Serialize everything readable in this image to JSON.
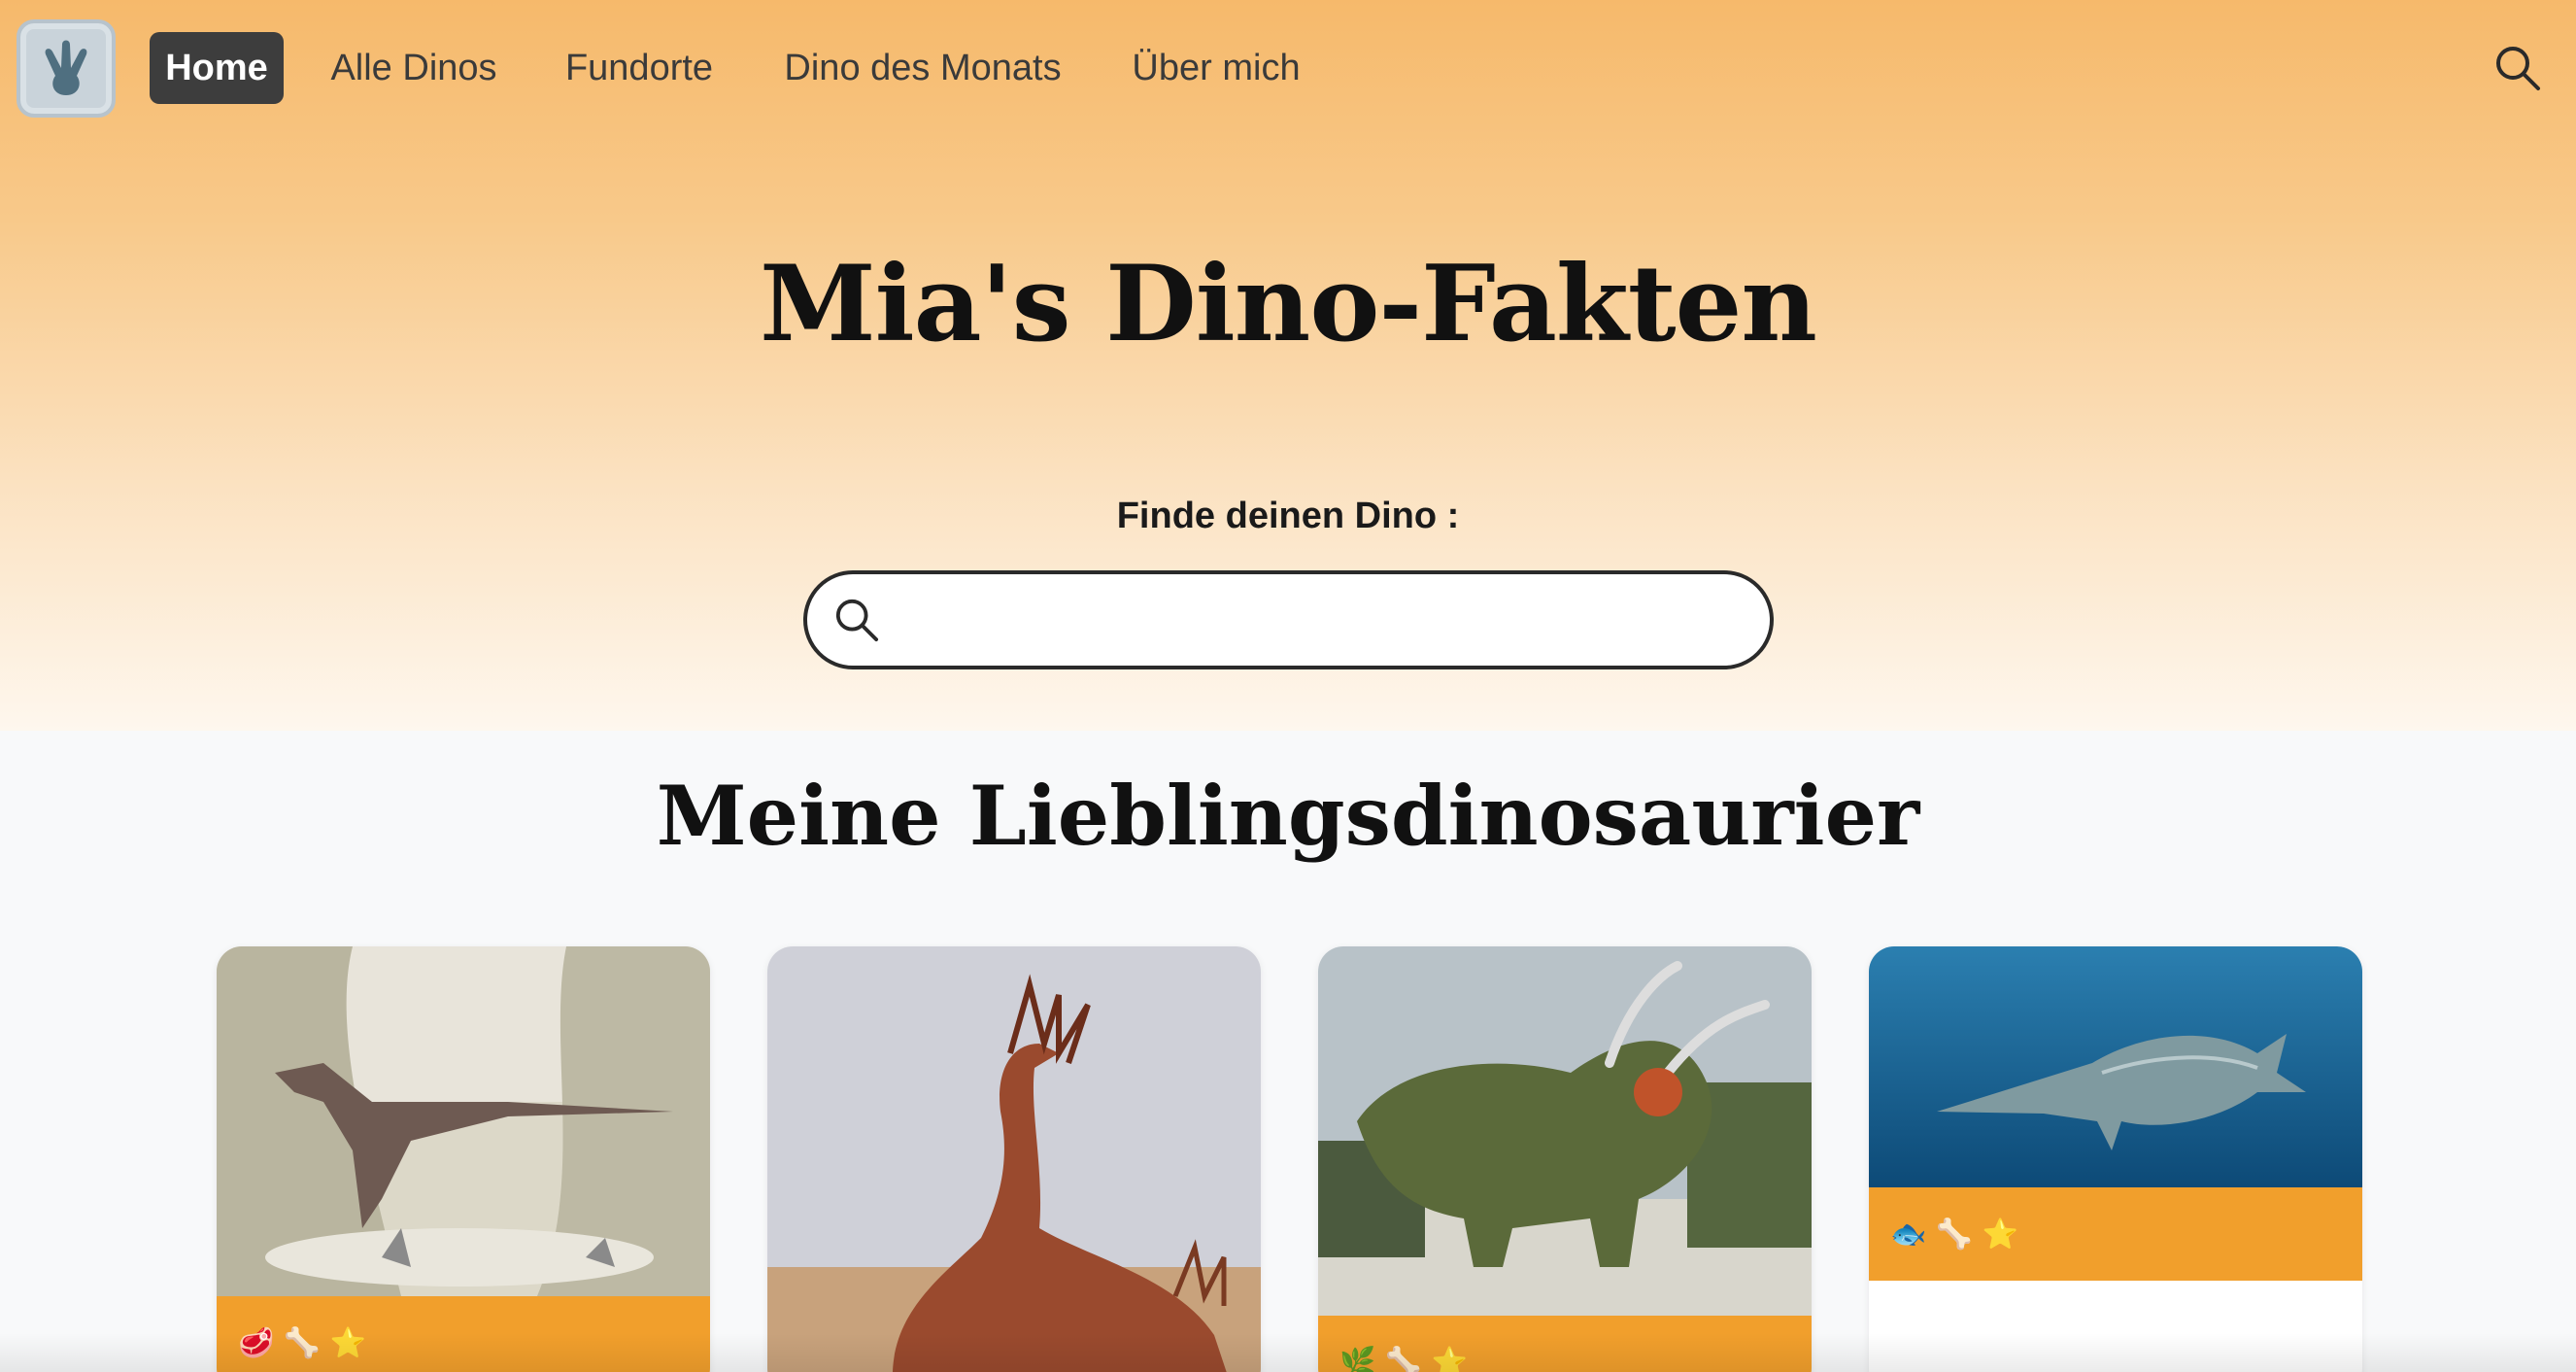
{
  "nav": {
    "logo_icon": "dino-footprint-icon",
    "items": [
      {
        "label": "Home",
        "active": true
      },
      {
        "label": "Alle Dinos",
        "active": false
      },
      {
        "label": "Fundorte",
        "active": false
      },
      {
        "label": "Dino des Monats",
        "active": false
      },
      {
        "label": "Über mich",
        "active": false
      }
    ],
    "search_icon": "search-icon"
  },
  "hero": {
    "title": "Mia's Dino-Fakten",
    "search_label": "Finde deinen Dino :",
    "search_value": "",
    "search_placeholder": ""
  },
  "favorites": {
    "title": "Meine Lieblingsdinosaurier",
    "cards": [
      {
        "image": "velociraptor-illustration",
        "diet_icon": "meat-icon",
        "icons": [
          "🥩",
          "🦴",
          "⭐"
        ]
      },
      {
        "image": "amargasaurus-illustration",
        "diet_icon": "meat-icon",
        "icons": []
      },
      {
        "image": "triceratops-illustration",
        "diet_icon": "plant-icon",
        "icons": [
          "🌿",
          "🦴",
          "⭐"
        ]
      },
      {
        "image": "ichthyosaur-illustration",
        "diet_icon": "fish-icon",
        "icons": [
          "🐟",
          "🦴",
          "⭐"
        ]
      }
    ]
  },
  "colors": {
    "accent": "#f19f2c",
    "nav_active_bg": "#3d3d3d",
    "hero_top": "#f6b96b"
  }
}
